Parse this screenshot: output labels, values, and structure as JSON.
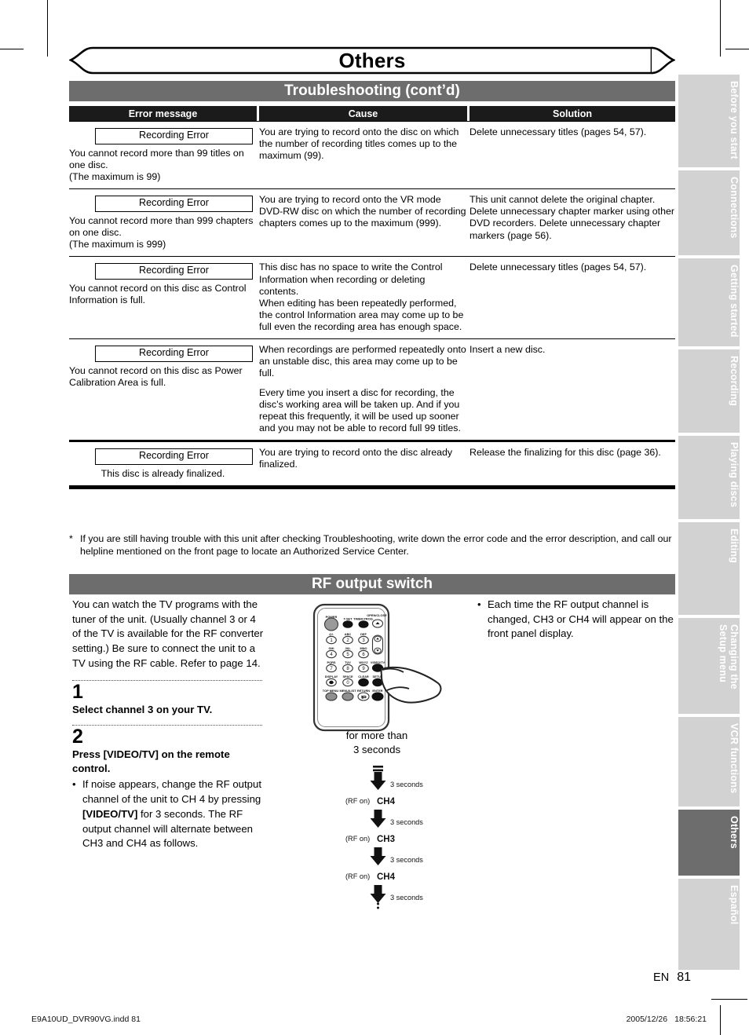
{
  "chapter": {
    "title": "Others"
  },
  "sections": {
    "troubleshooting": {
      "title": "Troubleshooting (cont’d)"
    },
    "rf": {
      "title": "RF output switch"
    }
  },
  "table": {
    "headers": [
      "Error message",
      "Cause",
      "Solution"
    ],
    "rows": [
      {
        "error_box": "Recording Error",
        "error_text": "You cannot record more than 99 titles on one disc.\n(The maximum is 99)",
        "cause": [
          "You are trying to record onto the disc on which the number of recording titles comes up to the maximum (99)."
        ],
        "solution": [
          "Delete unnecessary titles (pages 54, 57)."
        ]
      },
      {
        "error_box": "Recording Error",
        "error_text": "You cannot record more than 999 chapters on one disc.\n(The maximum is 999)",
        "cause": [
          "You are trying to record onto the VR mode DVD-RW disc on which the number of recording chapters comes up to the maximum (999)."
        ],
        "solution": [
          "This unit cannot delete the original chapter. Delete unnecessary chapter marker using other DVD recorders. Delete unnecessary chapter markers (page 56)."
        ]
      },
      {
        "error_box": "Recording Error",
        "error_text": "You cannot record on this disc as Control Information is full.",
        "cause": [
          "This disc has no space to write the Control Information when recording or deleting contents.",
          "When editing has been repeatedly performed, the control Information area may come up to be full even the recording area has enough space."
        ],
        "solution": [
          "Delete unnecessary titles (pages 54, 57)."
        ]
      },
      {
        "error_box": "Recording Error",
        "error_text": "You cannot record on this disc as Power Calibration Area is full.",
        "cause": [
          "When recordings are performed repeatedly onto an unstable disc, this area may come up to be full.",
          "Every time you insert a disc for recording, the disc’s working area will be taken up.  And if you repeat this frequently, it will be used up sooner and you may not be able to record full 99 titles."
        ],
        "solution": [
          "Insert a new disc."
        ]
      },
      {
        "error_box": "Recording Error",
        "error_text": "This disc is already finalized.",
        "error_text_center": true,
        "cause": [
          "You are trying to record onto the disc already finalized."
        ],
        "solution": [
          "Release the finalizing for this disc (page 36)."
        ]
      }
    ]
  },
  "footnote": {
    "marker": "*",
    "text": "If you are still having trouble with this unit after checking Troubleshooting, write down the error code and the error description, and call our helpline mentioned on the front page to locate an Authorized Service Center."
  },
  "rf_section": {
    "intro": "You can watch the TV programs with the tuner of the unit. (Usually channel 3 or 4 of the TV is available for the RF converter setting.) Be sure to connect the unit to a TV using the RF cable. Refer to page 14.",
    "step1_num": "1",
    "step1_title": "Select channel 3 on your TV.",
    "step2_num": "2",
    "step2_title": "Press [VIDEO/TV] on the remote control.",
    "step2_bullet_a": "If noise appears, change the RF output channel of the unit to CH 4 by pressing ",
    "step2_bullet_key": "[VIDEO/TV]",
    "step2_bullet_b": " for 3 seconds. The RF output channel will alternate between CH3 and CH4 as follows.",
    "right_bullet": "Each time the RF output channel is changed, CH3 or CH4 will appear on the front panel display.",
    "remote_caption_line1": "for more than",
    "remote_caption_line2": "3 seconds"
  },
  "remote": {
    "labels": {
      "power": "POWER",
      "t_set": "T-SET",
      "timer_prog": "TIMER PROG.",
      "open_close": "OPEN/CLOSE",
      "k1": "@!.",
      "k2": "ABC",
      "k3": "DEF",
      "k4": "GHI",
      "k5": "JKL",
      "k6": "MNO",
      "k7": "PQRS",
      "k8": "TUV",
      "k9": "WXYZ",
      "display": "DISPLAY",
      "space": "SPACE",
      "clear": "CLEAR",
      "top_menu": "TOP MENU",
      "menu_list": "MENU/LIST",
      "return": "RETURN",
      "ch": "CH",
      "video_tv": "VIDEO/TV",
      "setup": "SETUP",
      "enter": "ENTER",
      "n1": "1",
      "n2": "2",
      "n3": "3",
      "n4": "4",
      "n5": "5",
      "n6": "6",
      "n7": "7",
      "n8": "8",
      "n9": "9",
      "n0": "0"
    }
  },
  "flow": {
    "steps": [
      {
        "arrow_label": "3 seconds",
        "state_prefix": "(RF on)",
        "state": "CH4"
      },
      {
        "arrow_label": "3 seconds",
        "state_prefix": "(RF on)",
        "state": "CH3"
      },
      {
        "arrow_label": "3 seconds",
        "state_prefix": "(RF on)",
        "state": "CH4"
      },
      {
        "arrow_label": "3 seconds",
        "state_prefix": "",
        "state": ""
      }
    ]
  },
  "side_tabs": [
    {
      "label": "Before you start",
      "active": false
    },
    {
      "label": "Connections",
      "active": false
    },
    {
      "label": "Getting started",
      "active": false
    },
    {
      "label": "Recording",
      "active": false
    },
    {
      "label": "Playing discs",
      "active": false
    },
    {
      "label": "Editing",
      "active": false
    },
    {
      "label": "Changing the\nSetup menu",
      "active": false
    },
    {
      "label": "VCR functions",
      "active": false
    },
    {
      "label": "Others",
      "active": true
    },
    {
      "label": "Español",
      "active": false
    }
  ],
  "page_number": {
    "lang": "EN",
    "number": "81"
  },
  "footer": {
    "file": "E9A10UD_DVR90VG.indd   81",
    "date": "2005/12/26",
    "time": "18:56:21"
  },
  "colors": {
    "section_bar": "#6d6d6d",
    "table_header": "#1b1b1b",
    "tab_inactive": "#d2d2d2",
    "tab_active": "#6d6d6d"
  }
}
